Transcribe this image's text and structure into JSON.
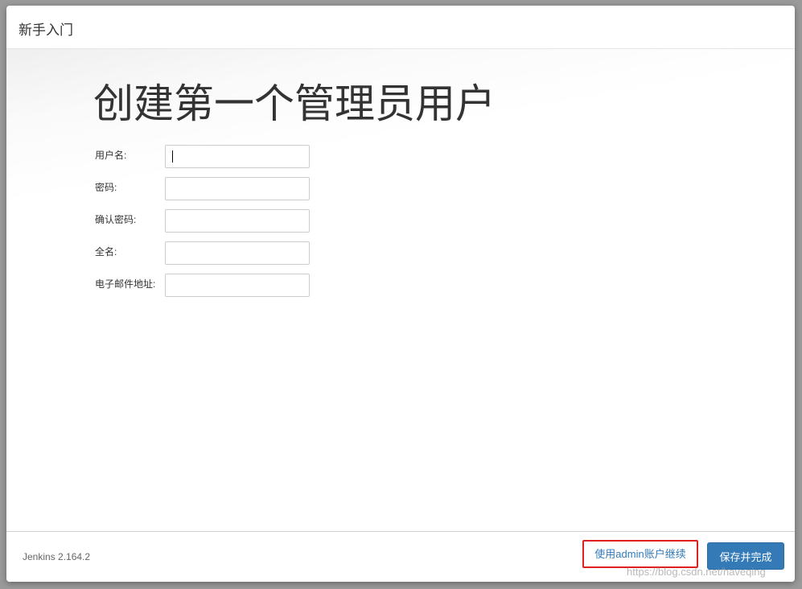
{
  "dialog": {
    "title": "新手入门"
  },
  "form": {
    "heading": "创建第一个管理员用户",
    "fields": [
      {
        "label": "用户名:",
        "value": ""
      },
      {
        "label": "密码:",
        "value": ""
      },
      {
        "label": "确认密码:",
        "value": ""
      },
      {
        "label": "全名:",
        "value": ""
      },
      {
        "label": "电子邮件地址:",
        "value": ""
      }
    ]
  },
  "footer": {
    "version": "Jenkins 2.164.2",
    "admin_link": "使用admin账户继续",
    "save_button": "保存并完成"
  },
  "watermark": "https://blog.csdn.net/haveqing",
  "colors": {
    "primary": "#337ab7",
    "highlight_border": "#e02020"
  }
}
